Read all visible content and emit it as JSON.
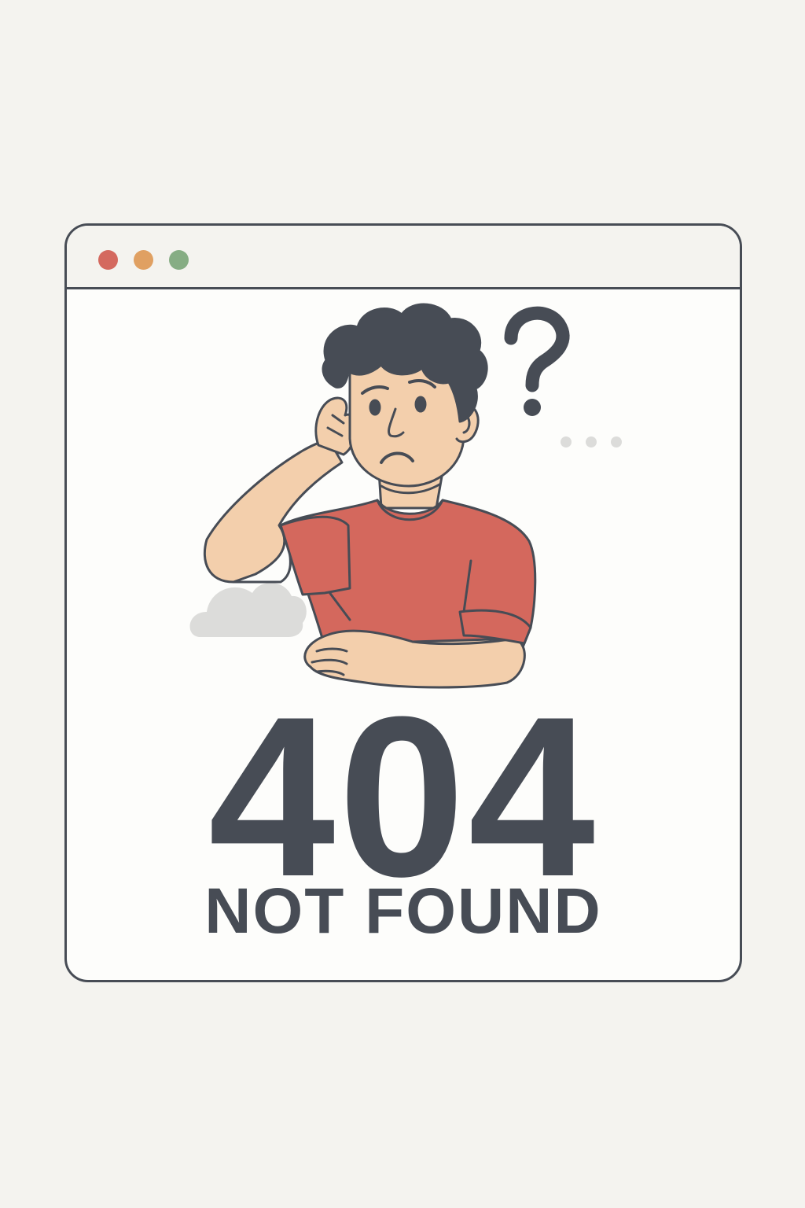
{
  "colors": {
    "background": "#f4f3ef",
    "window_border": "#474c55",
    "text": "#474c55",
    "shirt": "#d4685d",
    "skin": "#f3cfac",
    "hair": "#474c55",
    "cloud": "#dcdcda"
  },
  "window": {
    "controls": [
      {
        "name": "close",
        "color": "#d4695f"
      },
      {
        "name": "minimize",
        "color": "#e0a062"
      },
      {
        "name": "maximize",
        "color": "#86ad84"
      }
    ]
  },
  "error": {
    "code": "404",
    "message": "NOT FOUND"
  },
  "illustration": {
    "icons": [
      "cloud-icon",
      "question-mark-icon",
      "ellipsis-icon",
      "confused-person-icon"
    ]
  }
}
